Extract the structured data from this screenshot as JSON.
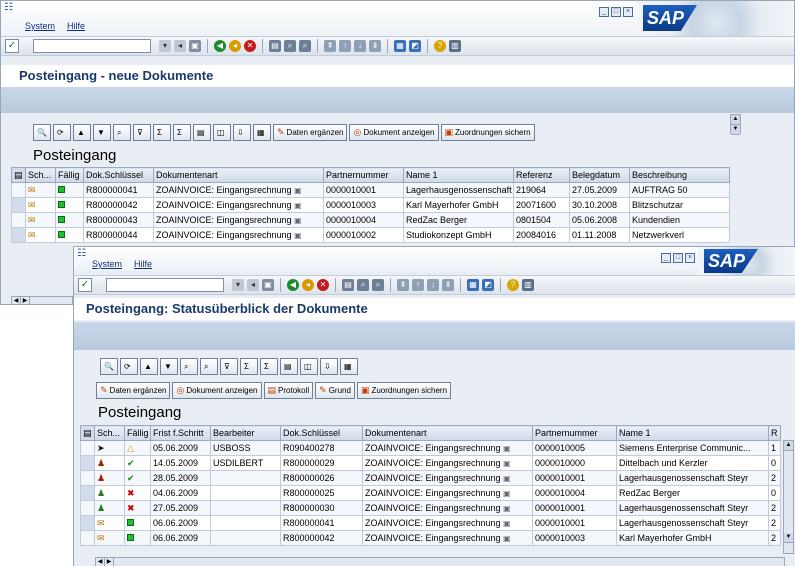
{
  "w1": {
    "menu": [
      "System",
      "Hilfe"
    ],
    "title": "Posteingang - neue Dokumente",
    "alv_title": "Posteingang",
    "buttons": [
      "Daten ergänzen",
      "Dokument anzeigen",
      "Zuordnungen sichern"
    ],
    "columns": [
      "Sch...",
      "Fällig",
      "Dok.Schlüssel",
      "Dokumentenart",
      "Partnernummer",
      "Name 1",
      "Referenz",
      "Belegdatum",
      "Beschreibung"
    ],
    "rows": [
      {
        "key": "R800000041",
        "type": "ZOAINVOICE: Eingangsrechnung",
        "partner": "0000010001",
        "name": "Lagerhausgenossenschaft ...",
        "ref": "219064",
        "date": "27.05.2009",
        "desc": "AUFTRAG 50"
      },
      {
        "key": "R800000042",
        "type": "ZOAINVOICE: Eingangsrechnung",
        "partner": "0000010003",
        "name": "Karl Mayerhofer GmbH",
        "ref": "20071600",
        "date": "30.10.2008",
        "desc": "Blitzschutzar"
      },
      {
        "key": "R800000043",
        "type": "ZOAINVOICE: Eingangsrechnung",
        "partner": "0000010004",
        "name": "RedZac Berger",
        "ref": "0801504",
        "date": "05.06.2008",
        "desc": "Kundendien"
      },
      {
        "key": "R800000044",
        "type": "ZOAINVOICE: Eingangsrechnung",
        "partner": "0000010002",
        "name": "Studiokonzept GmbH",
        "ref": "20084016",
        "date": "01.11.2008",
        "desc": "Netzwerkverl"
      }
    ]
  },
  "w2": {
    "menu": [
      "System",
      "Hilfe"
    ],
    "title": "Posteingang: Statusüberblick der Dokumente",
    "alv_title": "Posteingang",
    "buttons": [
      "Daten ergänzen",
      "Dokument anzeigen",
      "Protokoll",
      "Grund",
      "Zuordnungen sichern"
    ],
    "columns": [
      "Sch...",
      "Fällig",
      "Frist f.Schritt",
      "Bearbeiter",
      "Dok.Schlüssel",
      "Dokumentenart",
      "Partnernummer",
      "Name 1",
      "R"
    ],
    "rows": [
      {
        "status": "arrow",
        "due": "tri",
        "date": "05.06.2009",
        "user": "USBOSS",
        "key": "R090400278",
        "type": "ZOAINVOICE: Eingangsrechnung",
        "partner": "0000010005",
        "name": "Siemens Enterprise Communic...",
        "r": "1"
      },
      {
        "status": "user",
        "due": "chk",
        "date": "14.05.2009",
        "user": "USDILBERT",
        "key": "R800000029",
        "type": "ZOAINVOICE: Eingangsrechnung",
        "partner": "0000010000",
        "name": "Dittelbach und Kerzler",
        "r": "0"
      },
      {
        "status": "user",
        "due": "chk",
        "date": "28.05.2009",
        "user": "",
        "key": "R800000026",
        "type": "ZOAINVOICE: Eingangsrechnung",
        "partner": "0000010001",
        "name": "Lagerhausgenossenschaft Steyr",
        "r": "2"
      },
      {
        "status": "user",
        "due": "redx",
        "date": "04.06.2009",
        "user": "",
        "key": "R800000025",
        "type": "ZOAINVOICE: Eingangsrechnung",
        "partner": "0000010004",
        "name": "RedZac Berger",
        "r": "0"
      },
      {
        "status": "user",
        "due": "redx",
        "date": "27.05.2009",
        "user": "",
        "key": "R800000030",
        "type": "ZOAINVOICE: Eingangsrechnung",
        "partner": "0000010001",
        "name": "Lagerhausgenossenschaft Steyr",
        "r": "2"
      },
      {
        "status": "env",
        "due": "sq",
        "date": "06.06.2009",
        "user": "",
        "key": "R800000041",
        "type": "ZOAINVOICE: Eingangsrechnung",
        "partner": "0000010001",
        "name": "Lagerhausgenossenschaft Steyr",
        "r": "2"
      },
      {
        "status": "env",
        "due": "sq",
        "date": "06.06.2009",
        "user": "",
        "key": "R800000042",
        "type": "ZOAINVOICE: Eingangsrechnung",
        "partner": "0000010003",
        "name": "Karl Mayerhofer GmbH",
        "r": "2"
      }
    ]
  }
}
